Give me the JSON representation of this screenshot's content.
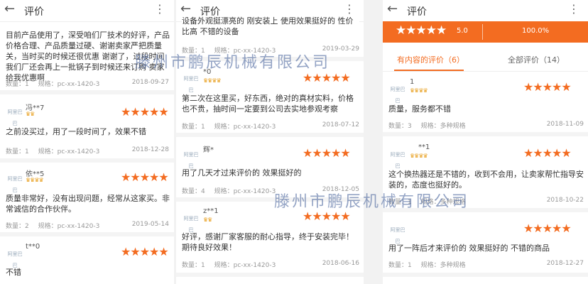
{
  "header": {
    "back": "←",
    "title": "评价",
    "more": "⋮"
  },
  "panel1": {
    "intro_text": "目前产品使用了，深受咱们厂技术的好评，产品价格合理、产品质量过硬、谢谢卖家严把质量关，当时买的时候还很优惠 谢谢了，过段时间我们厂还会再上一批锅子到时候还来订购 卖家给我优惠啊",
    "intro_meta": {
      "qty": "数量：1",
      "spec": "规格：pc-xx-1420-3",
      "date": "2018-09-27"
    },
    "reviews": [
      {
        "user": "冯**7",
        "stars": "★★★★★",
        "text": "之前没买过，用了一段时间了，效果不错",
        "qty": "数量：1",
        "spec": "规格：pc-xx-1420-3",
        "date": "2018-12-28"
      },
      {
        "user": "依**5",
        "stars": "★★★★★",
        "text": "质量非常好，没有出现问题，经常从这家买。非常诚信的合作伙伴。",
        "qty": "数量：2",
        "spec": "规格：pc-xx-1420-3",
        "date": "2019-05-14"
      },
      {
        "user": "t**0",
        "stars": "★★★★★",
        "text": "不错"
      }
    ]
  },
  "panel2": {
    "intro_text": "设备外观挺漂亮的 刚安装上 使用效果挺好的 性价比高 不错的设备",
    "intro_meta": {
      "qty": "数量：1",
      "spec": "规格：pc-xx-1420-3",
      "date": "2019-03-29"
    },
    "reviews": [
      {
        "user": "*0",
        "stars": "★★★★★",
        "text": "第二次在这里买，好东西，绝对的真材实料，价格也不贵，抽时间一定要到公司去实地参观考察",
        "qty": "数量：1",
        "spec": "规格：pc-xx-1420-3",
        "date": "2018-07-12"
      },
      {
        "user": "辉*",
        "stars": "★★★★★",
        "text": "用了几天才过来评价的 效果挺好的",
        "qty": "数量：4",
        "spec": "规格：pc-xx-1420-3",
        "date": "2018-12-05"
      },
      {
        "user": "z**1",
        "stars": "★★★★★",
        "text": "好评，感谢厂家客服的耐心指导，终于安装完毕！期待良好效果！",
        "qty": "数量：1",
        "spec": "规格：pc-xx-1420-3",
        "date": "2018-06-16"
      }
    ]
  },
  "panel3": {
    "summary": {
      "stars": "★★★★★",
      "score": "5.0",
      "rate": "100.0%"
    },
    "tabs": {
      "with_content": "有内容的评价（6）",
      "all": "全部评价（14）"
    },
    "reviews": [
      {
        "user": "1",
        "stars": "★★★★★",
        "text": "质量，服务都不错",
        "qty": "数量：3",
        "spec": "规格：多种规格",
        "date": "2018-11-09"
      },
      {
        "user": "**1",
        "stars": "★★★★★",
        "text": "这个换热器还是不错的，收到不会用，让卖家帮忙指导安装的，态度也挺好的。",
        "qty": "数量：1",
        "spec": "规格：多种规格",
        "date": "2018-10-22"
      },
      {
        "user": "",
        "stars": "★★★★★",
        "text": "用了一阵后才来评价的 效果挺好的 不错的商品",
        "qty": "数量：1",
        "spec": "规格：多种规格",
        "date": "2018-12-27"
      }
    ]
  },
  "watermark": "滕州市鹏辰机械有限公司",
  "colors": {
    "accent": "#f36c21",
    "badge": "#e8a020",
    "watermark": "#3c5a96"
  }
}
